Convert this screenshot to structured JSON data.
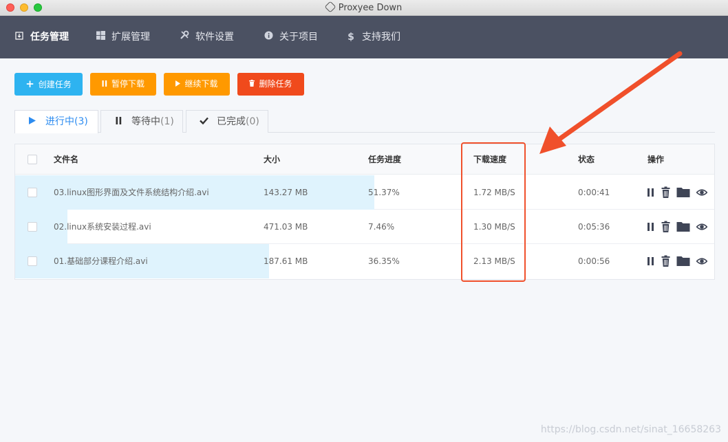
{
  "window": {
    "title": "Proxyee Down"
  },
  "nav": {
    "items": [
      {
        "label": "任务管理",
        "icon": "download-box-icon"
      },
      {
        "label": "扩展管理",
        "icon": "windows-icon"
      },
      {
        "label": "软件设置",
        "icon": "tools-icon"
      },
      {
        "label": "关于项目",
        "icon": "info-icon"
      },
      {
        "label": "支持我们",
        "icon": "dollar-icon"
      }
    ]
  },
  "toolbar": {
    "create": "创建任务",
    "pause": "暂停下载",
    "resume": "继续下载",
    "delete": "删除任务"
  },
  "tabs": [
    {
      "label": "进行中",
      "count": "(3)"
    },
    {
      "label": "等待中",
      "count": "(1)"
    },
    {
      "label": "已完成",
      "count": "(0)"
    }
  ],
  "table": {
    "headers": {
      "filename": "文件名",
      "size": "大小",
      "progress": "任务进度",
      "speed": "下载速度",
      "status": "状态",
      "actions": "操作"
    },
    "rows": [
      {
        "filename": "03.linux图形界面及文件系统结构介绍.avi",
        "size": "143.27 MB",
        "progress": "51.37%",
        "progress_value": 51.37,
        "speed": "1.72 MB/S",
        "status": "0:00:41"
      },
      {
        "filename": "02.linux系统安装过程.avi",
        "size": "471.03 MB",
        "progress": "7.46%",
        "progress_value": 7.46,
        "speed": "1.30 MB/S",
        "status": "0:05:36"
      },
      {
        "filename": "01.基础部分课程介绍.avi",
        "size": "187.61 MB",
        "progress": "36.35%",
        "progress_value": 36.35,
        "speed": "2.13 MB/S",
        "status": "0:00:56"
      }
    ]
  },
  "watermark": "https://blog.csdn.net/sinat_16658263",
  "colors": {
    "nav_bg": "#4b5162",
    "primary": "#2eb3f0",
    "warning": "#ff9900",
    "danger": "#f04a1c",
    "progress_fill": "#dff3fd",
    "annotation": "#f0502b"
  }
}
